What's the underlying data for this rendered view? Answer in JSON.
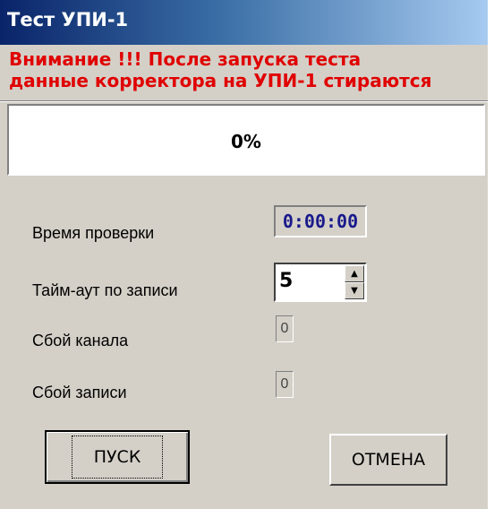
{
  "window": {
    "title": "Тест УПИ-1"
  },
  "warning": {
    "line1": "Внимание !!! После запуска теста",
    "line2": "данные корректора на УПИ-1 стираются"
  },
  "progress": {
    "text": "0%",
    "value": 0
  },
  "fields": {
    "check_time_label": "Время проверки",
    "check_time_value": "0:00:00",
    "timeout_label": "Тайм-аут по записи",
    "timeout_value": "5",
    "channel_fail_label": "Сбой канала",
    "channel_fail_value": "0",
    "write_fail_label": "Сбой записи",
    "write_fail_value": "0"
  },
  "buttons": {
    "start_label": "ПУСК",
    "cancel_label": "ОТМЕНА"
  },
  "colors": {
    "warning": "#e00000",
    "title_bar_start": "#0a246a",
    "title_bar_end": "#a6caf0",
    "time_text": "#1a1a8c"
  },
  "icons": {
    "spin_up": "triangle-up-icon",
    "spin_down": "triangle-down-icon"
  }
}
